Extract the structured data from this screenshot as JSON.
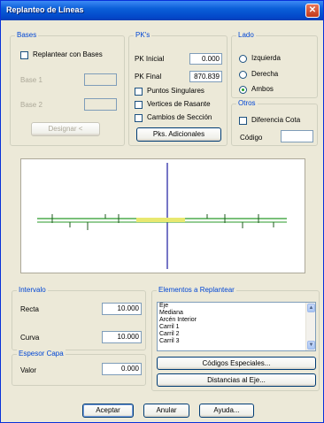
{
  "window": {
    "title": "Replanteo de Líneas",
    "close_glyph": "✕"
  },
  "bases": {
    "legend": "Bases",
    "replantear_label": "Replantear con Bases",
    "base1_label": "Base 1",
    "base2_label": "Base 2",
    "designar_label": "Designar <"
  },
  "pks": {
    "legend": "PK's",
    "pk_inicial_label": "PK Inicial",
    "pk_inicial_value": "0.000",
    "pk_final_label": "PK Final",
    "pk_final_value": "870.839",
    "puntos_singulares_label": "Puntos Singulares",
    "vertices_label": "Vertices de Rasante",
    "cambios_label": "Cambios de Sección",
    "adicionales_label": "Pks. Adicionales"
  },
  "lado": {
    "legend": "Lado",
    "izquierda_label": "Izquierda",
    "derecha_label": "Derecha",
    "ambos_label": "Ambos",
    "selected": "ambos"
  },
  "otros": {
    "legend": "Otros",
    "diferencia_cota_label": "Diferencia Cota",
    "codigo_label": "Código",
    "codigo_value": ""
  },
  "intervalo": {
    "legend": "Intervalo",
    "recta_label": "Recta",
    "recta_value": "10.000",
    "curva_label": "Curva",
    "curva_value": "10.000"
  },
  "espesor": {
    "legend": "Espesor Capa",
    "valor_label": "Valor",
    "valor_value": "0.000"
  },
  "elementos": {
    "legend": "Elementos a Replantear",
    "items": [
      "Eje",
      "Mediana",
      "Arcén Interior",
      "Carril 1",
      "Carril 2",
      "Carril 3"
    ],
    "codigos_label": "Códigos Especiales...",
    "distancias_label": "Distancias al Eje..."
  },
  "footer": {
    "aceptar_label": "Aceptar",
    "anular_label": "Anular",
    "ayuda_label": "Ayuda..."
  },
  "colors": {
    "title_bar": "#0a5fd8",
    "preview_axis": "#1a1aa0",
    "preview_line": "#2a9a2a",
    "preview_highlight": "#e8e870"
  },
  "icons": {
    "scroll_up": "▲",
    "scroll_down": "▼"
  }
}
